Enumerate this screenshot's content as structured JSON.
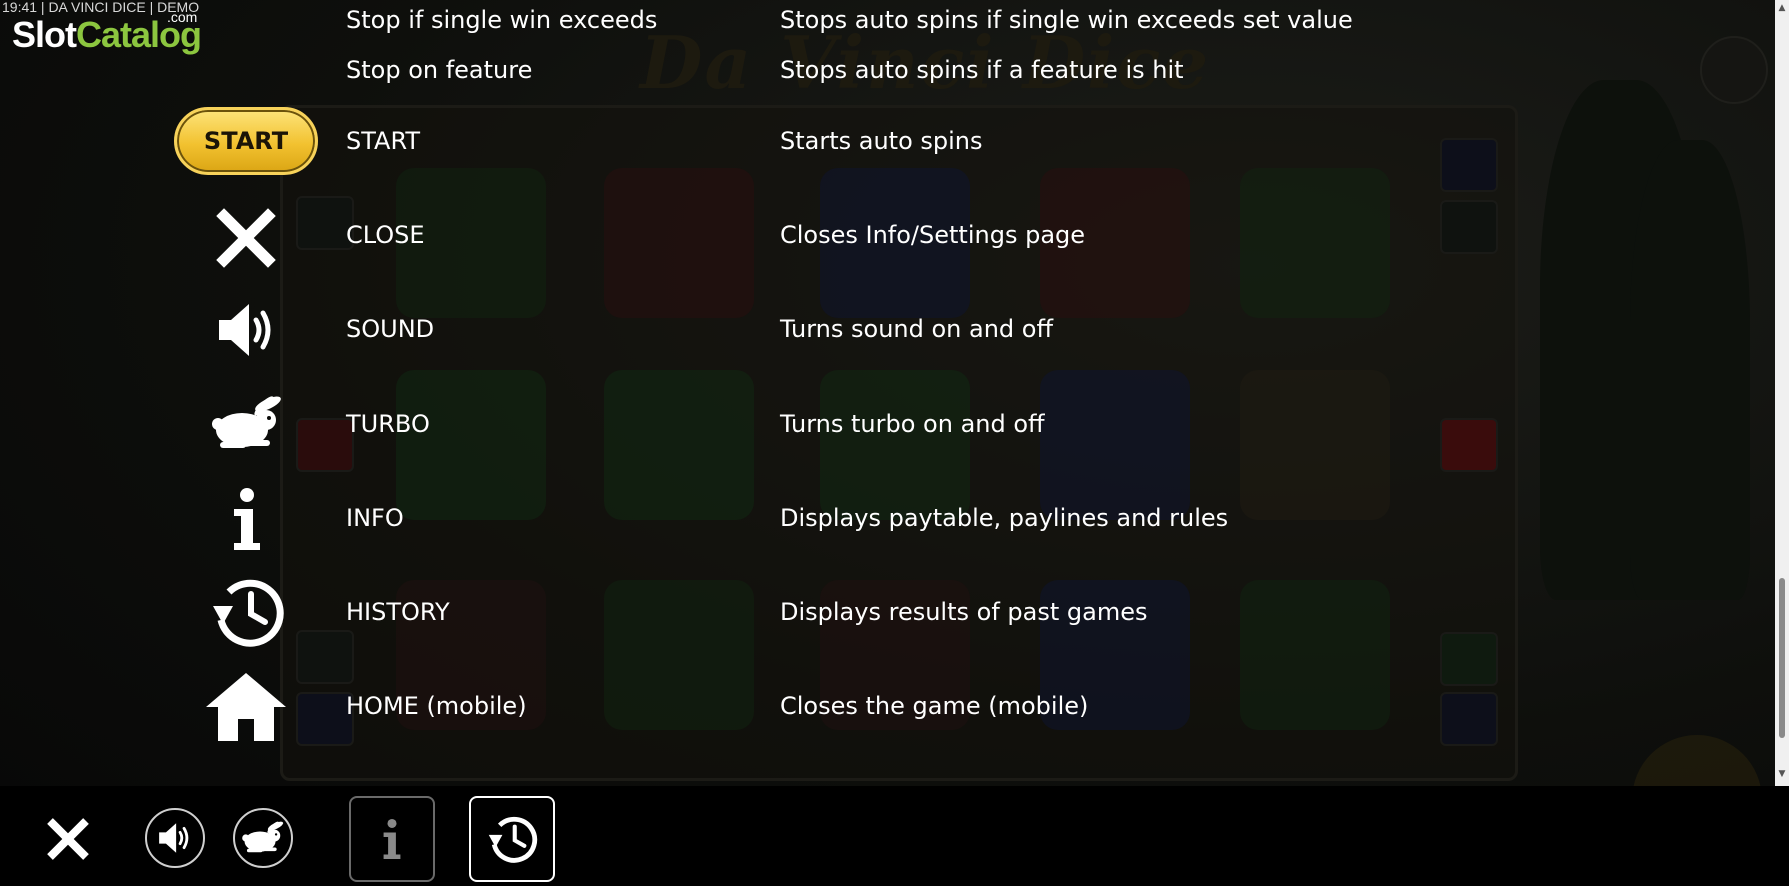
{
  "watermark": {
    "status_line": "19:41 | DA VINCI DICE | DEMO",
    "logo_slot": "Slot",
    "logo_catalog": "Catalog",
    "logo_com": ".com"
  },
  "game_title": "Da Vinci Dice",
  "rows": [
    {
      "label": "Stop if single win exceeds",
      "desc": "Stops auto spins if single win exceeds set value"
    },
    {
      "label": "Stop on feature",
      "desc": "Stops auto spins if a feature is hit"
    },
    {
      "label": "START",
      "desc": "Starts auto spins",
      "icon": "start-button",
      "button_text": "START"
    },
    {
      "label": "CLOSE",
      "desc": "Closes Info/Settings page",
      "icon": "close-icon"
    },
    {
      "label": "SOUND",
      "desc": "Turns sound on and off",
      "icon": "speaker-icon"
    },
    {
      "label": "TURBO",
      "desc": "Turns turbo on and off",
      "icon": "rabbit-icon"
    },
    {
      "label": "INFO",
      "desc": "Displays paytable, paylines and rules",
      "icon": "info-icon"
    },
    {
      "label": "HISTORY",
      "desc": "Displays results of past games",
      "icon": "history-icon"
    },
    {
      "label": "HOME (mobile)",
      "desc": "Closes the game (mobile)",
      "icon": "home-icon"
    }
  ],
  "bottom_bar": {
    "buttons": [
      "close-icon",
      "speaker-icon",
      "rabbit-icon",
      "info-icon",
      "history-icon"
    ],
    "active": "history-icon"
  },
  "colors": {
    "start_gold": "#f2c230",
    "watermark_green": "#8cc63f",
    "text": "#ffffff",
    "background": "#0b0b09"
  }
}
